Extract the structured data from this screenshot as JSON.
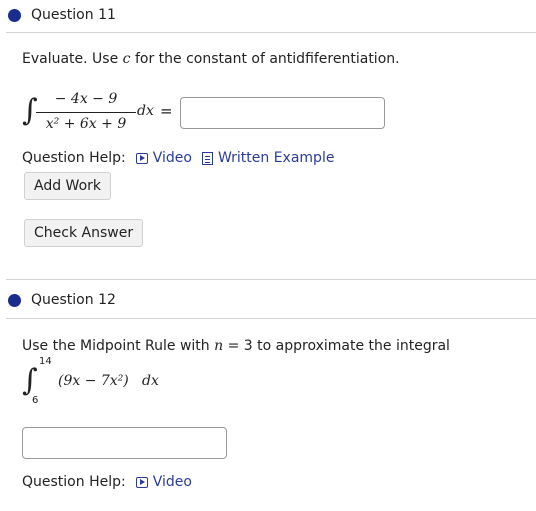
{
  "questions": [
    {
      "title": "Question 11",
      "prompt_before": "Evaluate. Use ",
      "prompt_var": "c",
      "prompt_after": " for the constant of antidfiferentiation.",
      "integral": {
        "symbol": "∫",
        "numerator": "− 4x − 9",
        "denominator": "x² + 6x + 9",
        "differential": "dx",
        "equals": "="
      },
      "help_label": "Question Help:",
      "video_label": "Video",
      "written_example_label": "Written Example",
      "add_work_label": "Add Work",
      "check_answer_label": "Check Answer"
    },
    {
      "title": "Question 12",
      "prompt_before": "Use the Midpoint Rule with ",
      "prompt_var": "n",
      "prompt_after": " = 3 to approximate the integral",
      "integral": {
        "symbol": "∫",
        "upper": "14",
        "lower": "6",
        "integrand": "(9x − 7x²)",
        "differential": "dx"
      },
      "help_label": "Question Help:",
      "video_label": "Video"
    }
  ],
  "colors": {
    "bullet": "#1a2c8c",
    "link": "#2a3c9a",
    "divider": "#d3d3d3"
  },
  "icons": [
    "video-icon",
    "document-icon"
  ]
}
